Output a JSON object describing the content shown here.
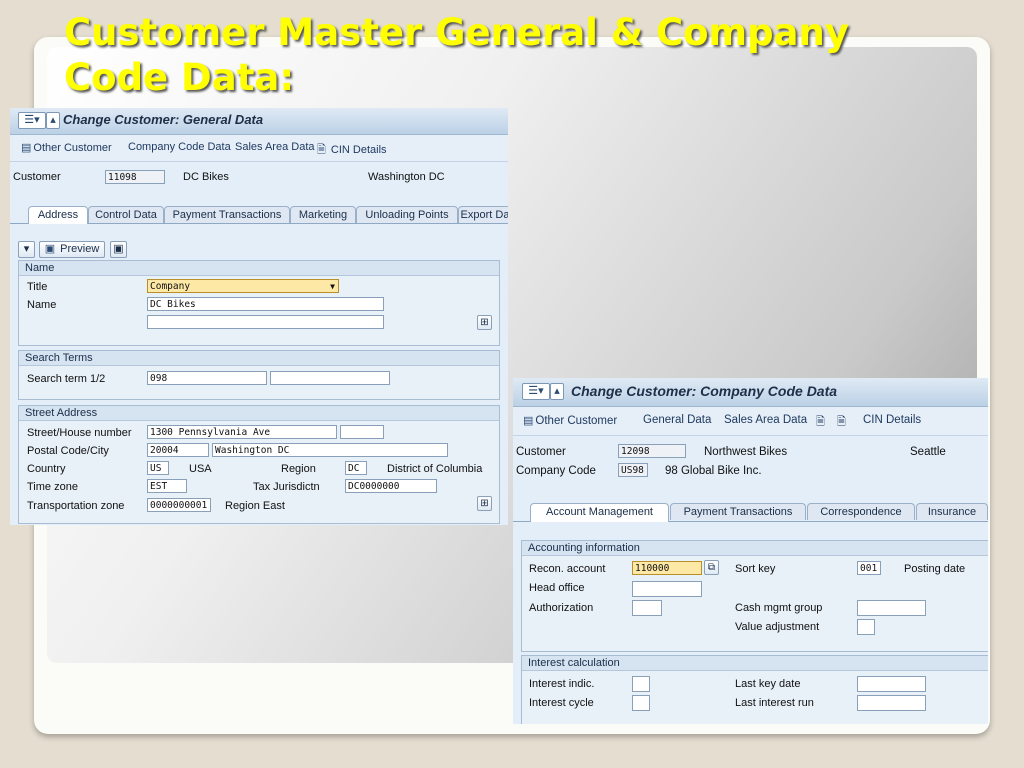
{
  "slide": {
    "title": "Customer Master General & Company Code Data:"
  },
  "general": {
    "title": "Change Customer: General Data",
    "toolbar": {
      "other_customer": "Other Customer",
      "company_code_data": "Company Code Data",
      "sales_area_data": "Sales Area Data",
      "cin_details": "CIN Details"
    },
    "customer_label": "Customer",
    "customer_value": "11098",
    "customer_name": "DC Bikes",
    "customer_city": "Washington DC",
    "tabs": [
      "Address",
      "Control Data",
      "Payment Transactions",
      "Marketing",
      "Unloading Points",
      "Export Da"
    ],
    "preview_label": "Preview",
    "name_group": {
      "header": "Name",
      "title_label": "Title",
      "title_value": "Company",
      "name_label": "Name",
      "name_value": "DC Bikes",
      "name2_value": ""
    },
    "search_group": {
      "header": "Search Terms",
      "label": "Search term 1/2",
      "value1": "098",
      "value2": ""
    },
    "street_group": {
      "header": "Street Address",
      "street_label": "Street/House number",
      "street_value": "1300 Pennsylvania Ave",
      "house_value": "",
      "postal_label": "Postal Code/City",
      "postal_value": "20004",
      "city_value": "Washington DC",
      "country_label": "Country",
      "country_value": "US",
      "country_name": "USA",
      "region_label": "Region",
      "region_value": "DC",
      "region_name": "District of Columbia",
      "timezone_label": "Time zone",
      "timezone_value": "EST",
      "taxjur_label": "Tax Jurisdictn",
      "taxjur_value": "DC0000000",
      "transport_label": "Transportation zone",
      "transport_value": "0000000001",
      "transport_name": "Region East"
    }
  },
  "company": {
    "title": "Change Customer: Company Code Data",
    "toolbar": {
      "other_customer": "Other Customer",
      "general_data": "General Data",
      "sales_area_data": "Sales Area Data",
      "cin_details": "CIN Details"
    },
    "customer_label": "Customer",
    "customer_value": "12098",
    "customer_name": "Northwest Bikes",
    "customer_city": "Seattle",
    "cc_label": "Company Code",
    "cc_value": "US98",
    "cc_name": "98 Global Bike Inc.",
    "tabs": [
      "Account Management",
      "Payment Transactions",
      "Correspondence",
      "Insurance"
    ],
    "accounting": {
      "header": "Accounting information",
      "recon_label": "Recon. account",
      "recon_value": "110000",
      "sort_label": "Sort key",
      "sort_value": "001",
      "posting_label": "Posting date",
      "head_label": "Head office",
      "head_value": "",
      "auth_label": "Authorization",
      "auth_value": "",
      "cash_label": "Cash mgmt group",
      "cash_value": "",
      "value_adj_label": "Value adjustment",
      "value_adj_value": ""
    },
    "interest": {
      "header": "Interest calculation",
      "indic_label": "Interest indic.",
      "indic_value": "",
      "lastkey_label": "Last key date",
      "lastkey_value": "",
      "cycle_label": "Interest cycle",
      "cycle_value": "",
      "lastrun_label": "Last interest run",
      "lastrun_value": ""
    }
  }
}
